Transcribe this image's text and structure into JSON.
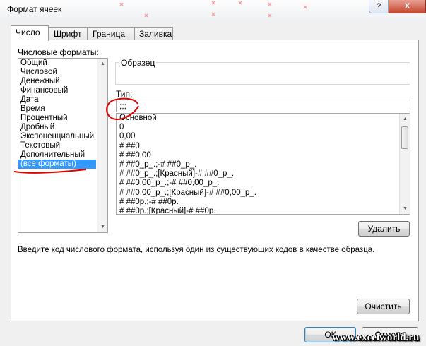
{
  "window": {
    "title": "Формат ячеек",
    "help_label": "?",
    "close_label": "X"
  },
  "tabs": [
    {
      "label": "Число",
      "active": true
    },
    {
      "label": "Шрифт",
      "active": false
    },
    {
      "label": "Граница",
      "active": false
    },
    {
      "label": "Заливка",
      "active": false
    }
  ],
  "categories": {
    "label": "Числовые форматы:",
    "items": [
      "Общий",
      "Числовой",
      "Денежный",
      "Финансовый",
      "Дата",
      "Время",
      "Процентный",
      "Дробный",
      "Экспоненциальный",
      "Текстовый",
      "Дополнительный",
      "(все форматы)"
    ],
    "selected": "(все форматы)"
  },
  "sample": {
    "label": "Образец"
  },
  "type": {
    "label": "Тип:",
    "value": ";;;",
    "formats": [
      "Основной",
      "0",
      "0,00",
      "# ##0",
      "# ##0,00",
      "# ##0_р_.;-# ##0_р_.",
      "# ##0_р_.;[Красный]-# ##0_р_.",
      "# ##0,00_р_.;-# ##0,00_р_.",
      "# ##0,00_р_.;[Красный]-# ##0,00_р_.",
      "# ##0р.;-# ##0р.",
      "# ##0р.;[Красный]-# ##0р."
    ]
  },
  "buttons": {
    "delete": "Удалить",
    "clear": "Очистить",
    "ok": "ОК",
    "cancel": "Отмена"
  },
  "hint": "Введите код числового формата, используя один из существующих кодов в качестве образца.",
  "watermark": "www.excelworld.ru",
  "colors": {
    "selection": "#3399ff",
    "annotation": "#e00000"
  }
}
